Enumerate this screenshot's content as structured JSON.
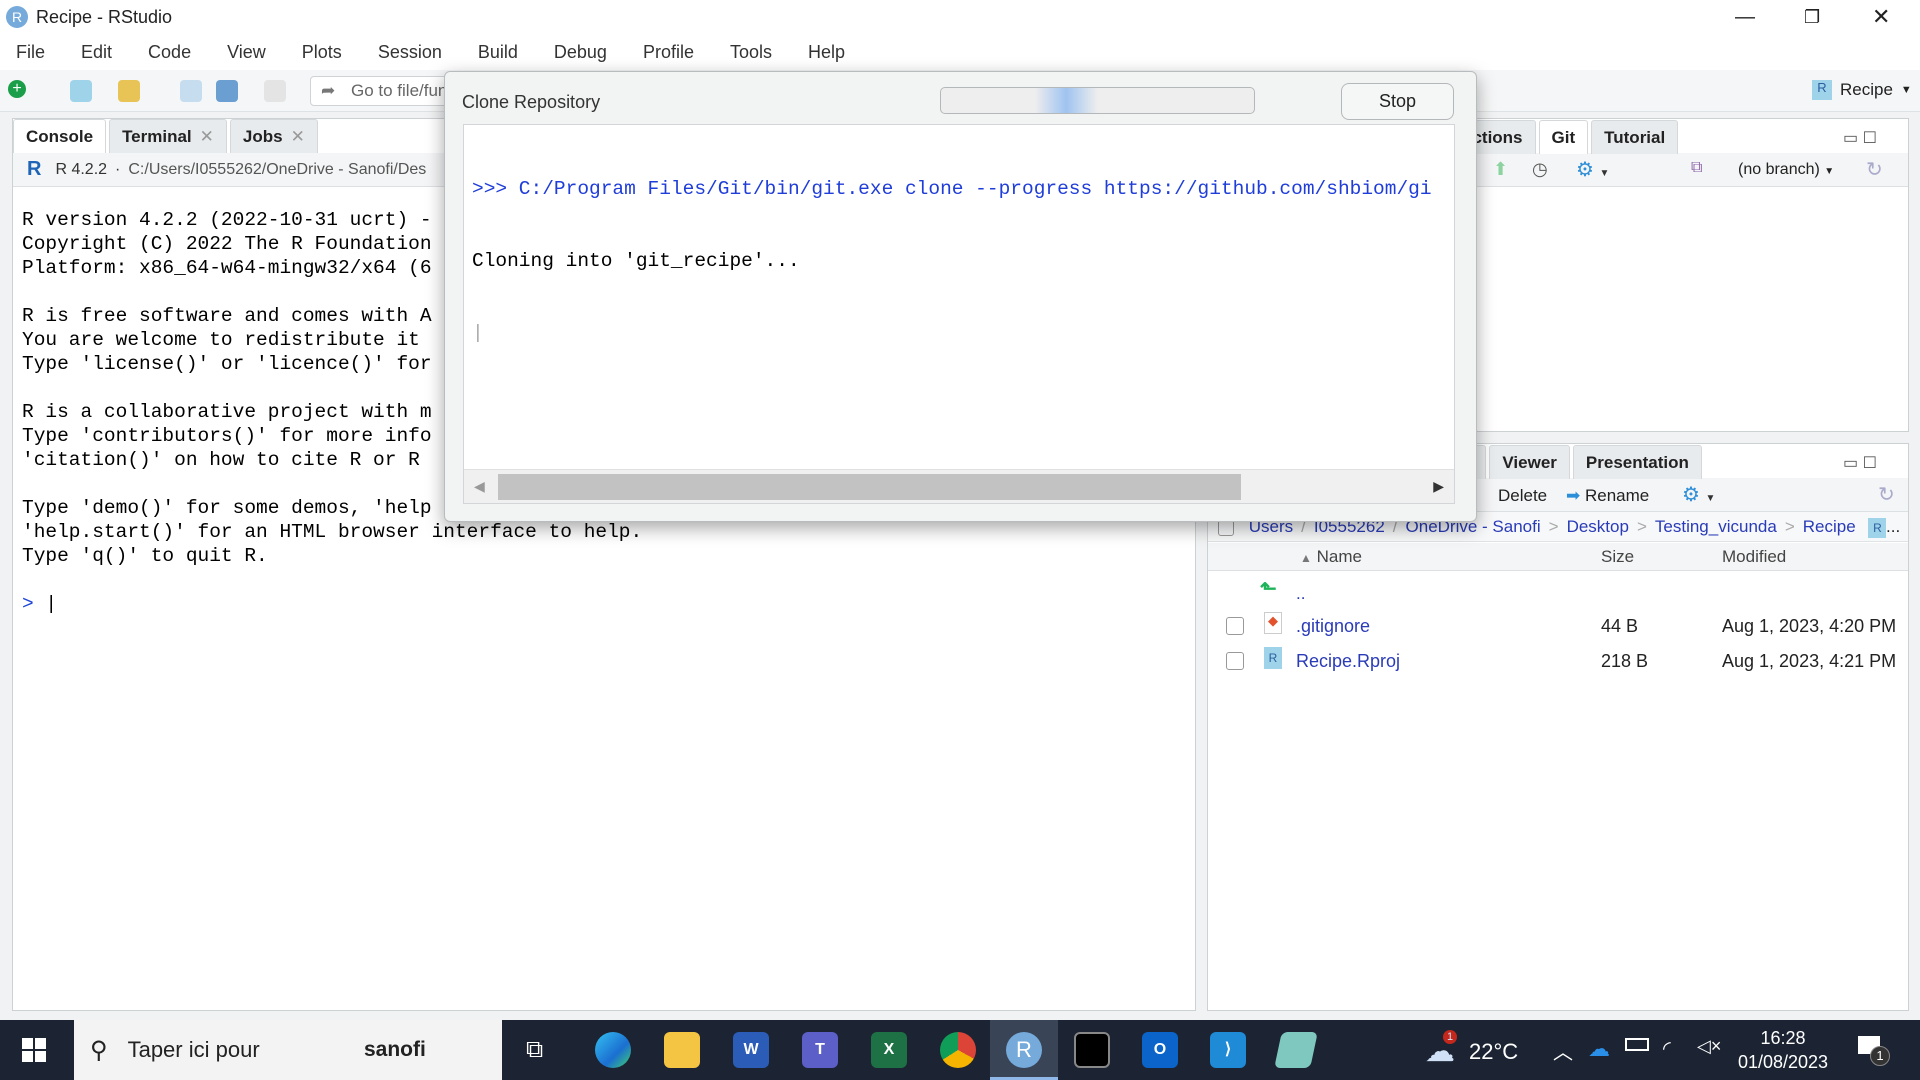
{
  "window": {
    "title": "Recipe - RStudio",
    "project": "Recipe"
  },
  "menu": [
    "File",
    "Edit",
    "Code",
    "View",
    "Plots",
    "Session",
    "Build",
    "Debug",
    "Profile",
    "Tools",
    "Help"
  ],
  "toolbar": {
    "goto_placeholder": "Go to file/fun"
  },
  "console": {
    "tabs": [
      {
        "label": "Console"
      },
      {
        "label": "Terminal"
      },
      {
        "label": "Jobs"
      }
    ],
    "r_version": "R 4.2.2",
    "path": "C:/Users/I0555262/OneDrive - Sanofi/Des",
    "lines": [
      "R version 4.2.2 (2022-10-31 ucrt) -",
      "Copyright (C) 2022 The R Foundation",
      "Platform: x86_64-w64-mingw32/x64 (6",
      "",
      "R is free software and comes with A",
      "You are welcome to redistribute it",
      "Type 'license()' or 'licence()' for",
      "",
      "R is a collaborative project with m",
      "Type 'contributors()' for more info",
      "'citation()' on how to cite R or R",
      "",
      "Type 'demo()' for some demos, 'help",
      "'help.start()' for an HTML browser interface to help.",
      "Type 'q()' to quit R.",
      "",
      ">"
    ]
  },
  "dialog": {
    "title": "Clone Repository",
    "stop_label": "Stop",
    "output": [
      ">>> C:/Program Files/Git/bin/git.exe clone --progress https://github.com/shbiom/gi",
      "Cloning into 'git_recipe'..."
    ]
  },
  "upper_right": {
    "tabs": [
      "ections",
      "Git",
      "Tutorial"
    ],
    "branch": "(no branch)"
  },
  "lower_right": {
    "tabs": [
      "p",
      "Viewer",
      "Presentation"
    ],
    "toolbar": {
      "delete": "Delete",
      "rename": "Rename"
    },
    "breadcrumb": [
      "Users",
      "I0555262",
      "OneDrive - Sanofi",
      "Desktop",
      "Testing_vicunda",
      "Recipe"
    ],
    "more": "...",
    "columns": [
      "Name",
      "Size",
      "Modified"
    ],
    "up": "..",
    "files": [
      {
        "name": ".gitignore",
        "size": "44 B",
        "modified": "Aug 1, 2023, 4:20 PM",
        "icon": "git-file-icon"
      },
      {
        "name": "Recipe.Rproj",
        "size": "218 B",
        "modified": "Aug 1, 2023, 4:21 PM",
        "icon": "rproj-icon"
      }
    ]
  },
  "taskbar": {
    "search": "Taper ici pour",
    "brand": "sanofi",
    "weather": "22°C",
    "weather_badge": "1",
    "time": "16:28",
    "date": "01/08/2023",
    "notif_count": "1"
  }
}
